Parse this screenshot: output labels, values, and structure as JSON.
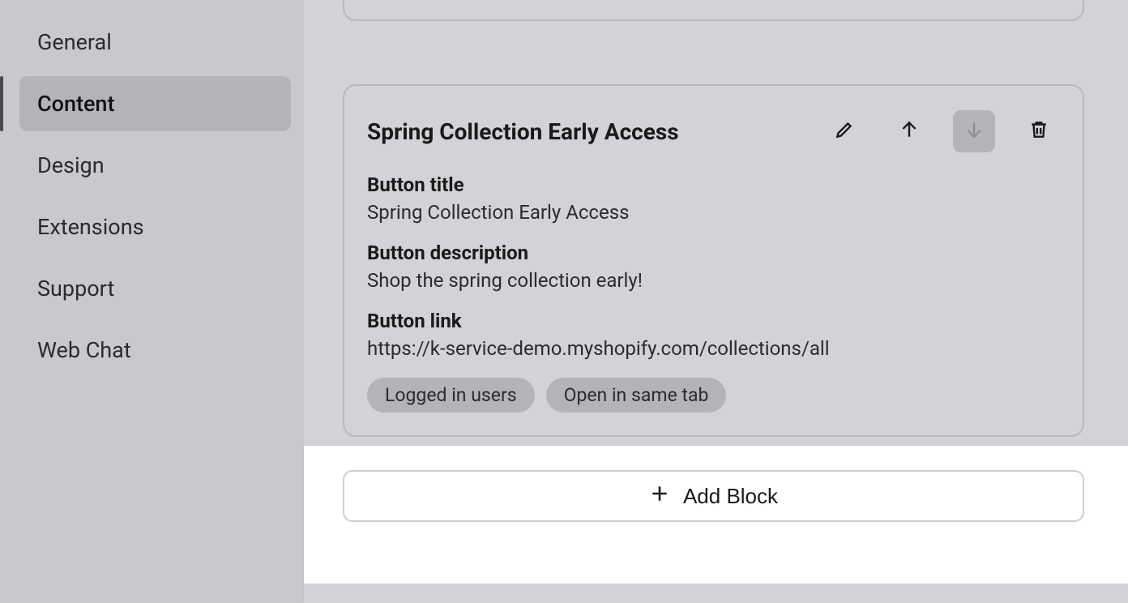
{
  "sidebar": {
    "items": [
      {
        "label": "General"
      },
      {
        "label": "Content"
      },
      {
        "label": "Design"
      },
      {
        "label": "Extensions"
      },
      {
        "label": "Support"
      },
      {
        "label": "Web Chat"
      }
    ],
    "activeIndex": 1
  },
  "block": {
    "title": "Spring Collection Early Access",
    "fields": {
      "button_title_label": "Button title",
      "button_title_value": "Spring Collection Early Access",
      "button_description_label": "Button description",
      "button_description_value": "Shop the spring collection early!",
      "button_link_label": "Button link",
      "button_link_value": "https://k-service-demo.myshopify.com/collections/all"
    },
    "tags": [
      "Logged in users",
      "Open in same tab"
    ]
  },
  "actions": {
    "add_block_label": "Add Block"
  }
}
